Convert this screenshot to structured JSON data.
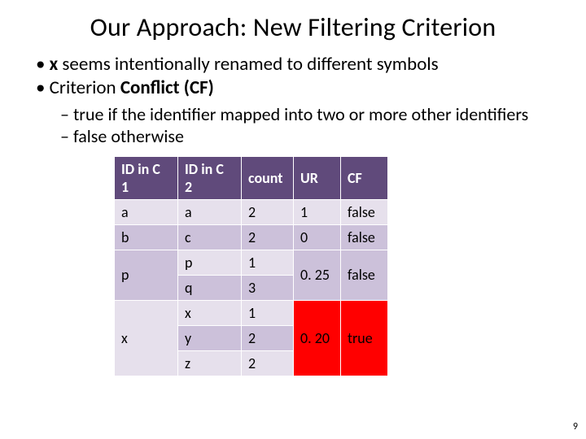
{
  "title": "Our Approach: New Filtering Criterion",
  "bullets": {
    "b1_pre": "",
    "b1_bold": "x",
    "b1_rest": " seems intentionally renamed to different symbols",
    "b2_pre": "Criterion ",
    "b2_bold": "Conflict (CF)"
  },
  "sub": {
    "s1": "true if the identifier mapped into two or more other identifiers",
    "s2": "false otherwise"
  },
  "headers": {
    "id1": "ID in C 1",
    "id2": "ID in C 2",
    "count": "count",
    "ur": "UR",
    "cf": "CF"
  },
  "rows": {
    "r1": {
      "id1": "a",
      "id2": "a",
      "count": "2",
      "ur": "1",
      "cf": "false"
    },
    "r2": {
      "id1": "b",
      "id2": "c",
      "count": "2",
      "ur": "0",
      "cf": "false"
    },
    "r3": {
      "id2": "p",
      "count": "1"
    },
    "r4": {
      "id1": "p",
      "id2": "q",
      "count": "3",
      "ur": "0. 25",
      "cf": "false"
    },
    "r5": {
      "id2": "x",
      "count": "1"
    },
    "r6": {
      "id1": "x",
      "id2": "y",
      "count": "2",
      "ur": "0. 20",
      "cf": "true"
    },
    "r7": {
      "id2": "z",
      "count": "2"
    }
  },
  "pagenum": "9",
  "chart_data": {
    "type": "table",
    "title": "Our Approach: New Filtering Criterion",
    "columns": [
      "ID in C 1",
      "ID in C 2",
      "count",
      "UR",
      "CF"
    ],
    "rows": [
      [
        "a",
        "a",
        2,
        1,
        "false"
      ],
      [
        "b",
        "c",
        2,
        0,
        "false"
      ],
      [
        "p",
        "p",
        1,
        0.25,
        "false"
      ],
      [
        "p",
        "q",
        3,
        0.25,
        "false"
      ],
      [
        "x",
        "x",
        1,
        0.2,
        "true"
      ],
      [
        "x",
        "y",
        2,
        0.2,
        "true"
      ],
      [
        "x",
        "z",
        2,
        0.2,
        "true"
      ]
    ],
    "notes": "UR and CF span merged groups; x-group CF=true highlighted in red"
  }
}
